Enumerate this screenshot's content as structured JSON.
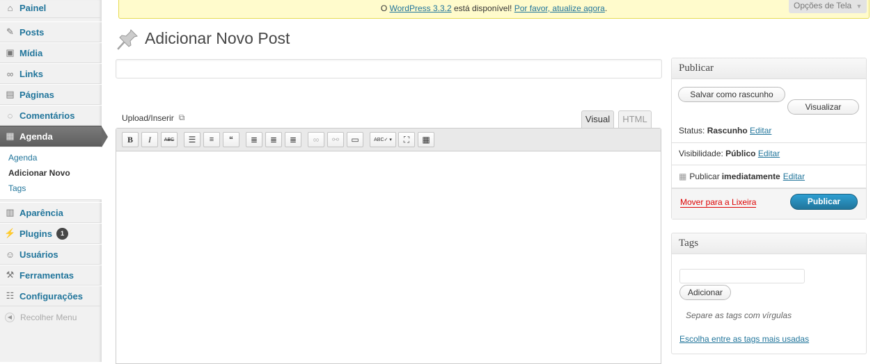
{
  "sidebar": {
    "items": [
      {
        "label": "Painel",
        "icon": "home-icon"
      },
      {
        "label": "Posts",
        "icon": "pushpin-icon"
      },
      {
        "label": "Mídia",
        "icon": "media-icon"
      },
      {
        "label": "Links",
        "icon": "link-icon"
      },
      {
        "label": "Páginas",
        "icon": "pages-icon"
      },
      {
        "label": "Comentários",
        "icon": "comment-icon"
      },
      {
        "label": "Agenda",
        "icon": "calendar-icon"
      },
      {
        "label": "Aparência",
        "icon": "appearance-icon"
      },
      {
        "label": "Plugins",
        "icon": "plugin-icon",
        "badge": "1"
      },
      {
        "label": "Usuários",
        "icon": "users-icon"
      },
      {
        "label": "Ferramentas",
        "icon": "tools-icon"
      },
      {
        "label": "Configurações",
        "icon": "settings-icon"
      }
    ],
    "submenu": [
      "Agenda",
      "Adicionar Novo",
      "Tags"
    ],
    "collapse_label": "Recolher Menu"
  },
  "notice": {
    "prefix": "O ",
    "version_link": "WordPress 3.3.2",
    "middle": " está disponível! ",
    "update_link": "Por favor, atualize agora",
    "suffix": "."
  },
  "screen_options": "Opções de Tela",
  "page_title": "Adicionar Novo Post",
  "editor": {
    "upload_label": "Upload/Inserir",
    "tab_visual": "Visual",
    "tab_html": "HTML",
    "title_value": "",
    "content_value": ""
  },
  "publish_box": {
    "title": "Publicar",
    "save_draft": "Salvar como rascunho",
    "preview": "Visualizar",
    "status_label": "Status: ",
    "status_value": "Rascunho",
    "visibility_label": "Visibilidade: ",
    "visibility_value": "Público",
    "schedule_label": "Publicar ",
    "schedule_value": "imediatamente",
    "edit": "Editar",
    "trash": "Mover para a Lixeira",
    "publish": "Publicar"
  },
  "tags_box": {
    "title": "Tags",
    "add_button": "Adicionar",
    "hint": "Separe as tags com vírgulas",
    "choose_link": "Escolha entre as tags mais usadas"
  },
  "colors": {
    "link": "#21759b",
    "notice_bg": "#fffbcc",
    "publish_btn": "#21759b",
    "trash": "#dd0000"
  }
}
